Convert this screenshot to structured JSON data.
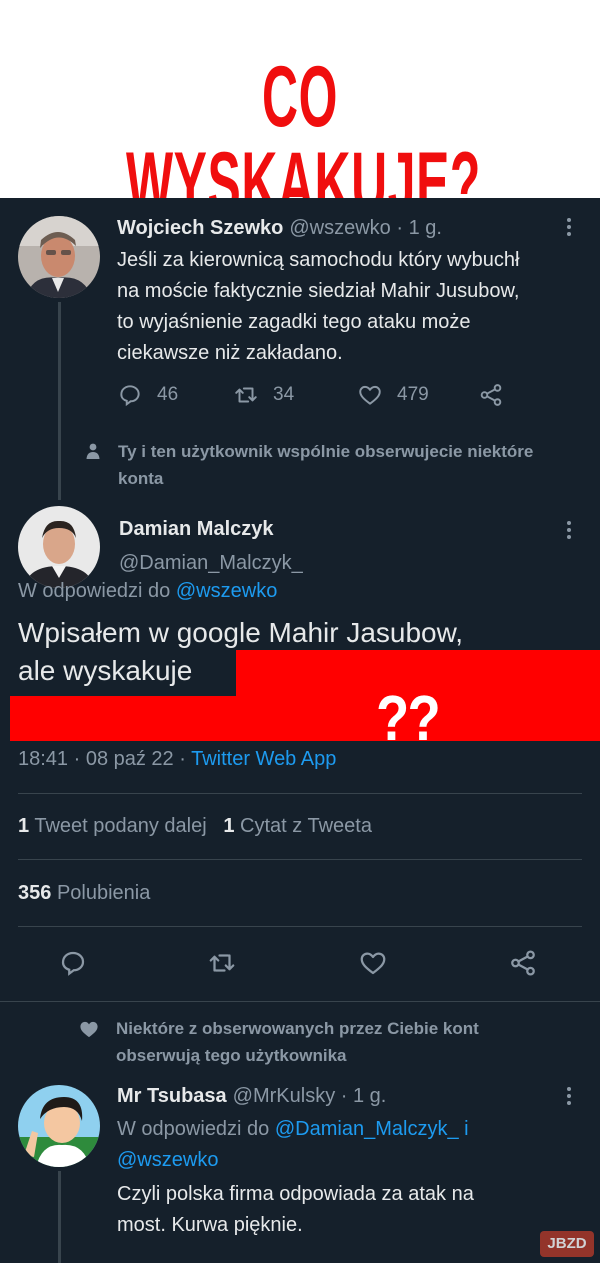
{
  "banner": {
    "title": "CO WYSKAKUJE?"
  },
  "tweet1": {
    "display_name": "Wojciech Szewko",
    "meta": "@wszewko · 1 g.",
    "text_lines": [
      "Jeśli za kierownicą samochodu który wybuchł",
      "na moście faktycznie siedział Mahir Jusubow,",
      "to wyjaśnienie zagadki tego ataku może",
      "ciekawsze niż zakładano."
    ],
    "replies": "46",
    "retweets": "34",
    "likes": "479"
  },
  "social_context_1": {
    "line1": "Ty i ten użytkownik wspólnie obserwujecie niektóre",
    "line2": "konta"
  },
  "main_tweet": {
    "display_name": "Damian Malczyk",
    "handle": "@Damian_Malczyk_",
    "reply_prefix": "W odpowiedzi do",
    "reply_to": "@wszewko",
    "text_line1": "Wpisałem w google Mahir Jasubow,",
    "text_line2": "ale wyskakuje",
    "overlay_marks": "??",
    "time": "18:41 · 08 paź 22 ·",
    "client": "Twitter Web App",
    "retweets_count": "1",
    "retweets_label": "Tweet podany dalej",
    "quotes_count": "1",
    "quotes_label": "Cytat z Tweeta",
    "likes_count": "356",
    "likes_label": "Polubienia"
  },
  "social_context_2": {
    "line1": "Niektóre z obserwowanych przez Ciebie kont",
    "line2": "obserwują tego użytkownika"
  },
  "reply_tweet": {
    "display_name": "Mr Tsubasa",
    "meta": "@MrKulsky · 1 g.",
    "reply_prefix": "W odpowiedzi do",
    "reply_to_1": "@Damian_Malczyk_",
    "reply_joiner": "i",
    "reply_to_2": "@wszewko",
    "text_lines": [
      "Czyli polska firma odpowiada za atak na",
      "most. Kurwa pięknie."
    ]
  },
  "watermark": "JBZD",
  "colors": {
    "background": "#15202b",
    "accent": "#1d9bf0",
    "title_red": "#f00e0e",
    "redaction": "#ff0000"
  }
}
